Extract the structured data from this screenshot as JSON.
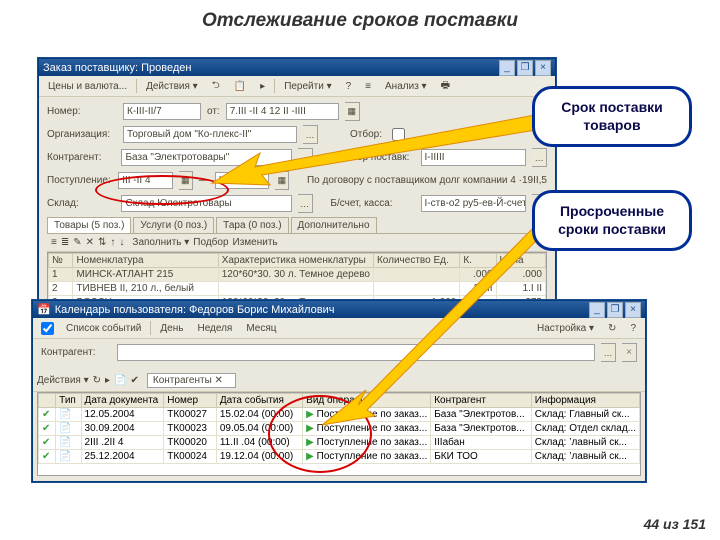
{
  "title": "Отслеживание сроков поставки",
  "win1": {
    "title": "Заказ поставщику: Проведен",
    "tb": {
      "price": "Цены и валюта...",
      "actions": "Действия ▾",
      "go": "Перейти ▾",
      "analysis": "Анализ ▾"
    },
    "form": {
      "number_lbl": "Номер:",
      "number": "К-III-II/7",
      "date_lbl": "от:",
      "date": "7.III -II 4 12 II -IIII",
      "org_lbl": "Организация:",
      "org": "Торговый дом \"Ко-плекс-II\"",
      "otbor_lbl": "Отбор:",
      "contragent_lbl": "Контрагент:",
      "contragent": "База \"Электротовары\"",
      "dogovor_lbl": "Договор поставк:",
      "dogovor": "I-IIIII",
      "post_lbl": "Поступление:",
      "post_from": "III -II 4",
      "post_to": "III -II 4",
      "post_desc": "По договору с поставщиком долг компании 4 ·19II,5",
      "sklad_lbl": "Склад:",
      "sklad": "Склад Юлектротовары",
      "bank_lbl": "Б/счет, касса:",
      "bank": "I-ств-о2 ру5-ев-Й-счет"
    },
    "tabs": [
      "Товары (5 поз.)",
      "Услуги (0 поз.)",
      "Тара (0 поз.)",
      "Дополнительно"
    ],
    "subbar": {
      "fill": "Заполнить ▾",
      "pick": "Подбор",
      "change": "Изменить"
    },
    "grid_head": [
      "№",
      "Номенклатура",
      "Характеристика номенклатуры",
      "Количество Ед.",
      "К.",
      "Цена"
    ],
    "rows": [
      {
        "n": "1",
        "name": "МИНСК-АТЛАНТ 215",
        "spec": "120*60*30. 30 л. Темное дерево",
        "qty": "",
        "k": ".000",
        "price": ".000"
      },
      {
        "n": "2",
        "name": "ТИВНЕВ II, 210 л., белый",
        "spec": "",
        "qty": "",
        "k": "1.I II",
        "price": "1.I II"
      },
      {
        "n": "3",
        "name": "BOSCH",
        "spec": "120*60*30. 30 л. Темное дерево",
        "qty": "1,200",
        "k": "",
        "price": "375"
      }
    ]
  },
  "win2": {
    "title": "Календарь пользователя: Федоров Борис Михайлович",
    "tb": {
      "list": "Список событий",
      "day": "День",
      "week": "Неделя",
      "month": "Месяц",
      "settings": "Настройка ▾"
    },
    "contragent_lbl": "Контрагент:",
    "actions": "Действия ▾",
    "selectall": "Контрагенты ✕",
    "grid_head": [
      "",
      "Тип",
      "Дата документа",
      "Номер",
      "Дата события",
      "Вид операции",
      "Контрагент",
      "Информация"
    ],
    "rows": [
      {
        "t": "",
        "date": "12.05.2004",
        "num": "ТК00027",
        "evt": "15.02.04 (00:00)",
        "op": "Поступление по заказ...",
        "k": "База \"Электротов...",
        "info": "Склад: Главный ск..."
      },
      {
        "t": "",
        "date": "30.09.2004",
        "num": "ТК00023",
        "evt": "09.05.04 (00:00)",
        "op": "Поступление по заказ...",
        "k": "База \"Электротов...",
        "info": "Склад: Отдел склад..."
      },
      {
        "t": "",
        "date": "2III .2II 4",
        "num": "ТК00020",
        "evt": "11.II .04 (00:00)",
        "op": "Поступление по заказ...",
        "k": "IIIабан",
        "info": "Склад: ’лавный ск..."
      },
      {
        "t": "",
        "date": "25.12.2004",
        "num": "ТК00024",
        "evt": "19.12.04 (00:00)",
        "op": "Поступление по заказ...",
        "k": "БКИ ТОО",
        "info": "Склад: ’лавный ск..."
      }
    ]
  },
  "callout1": "Срок поставки товаров",
  "callout2": "Просроченные сроки поставки",
  "footer_current": "44",
  "footer_sep": " из ",
  "footer_total": "151"
}
